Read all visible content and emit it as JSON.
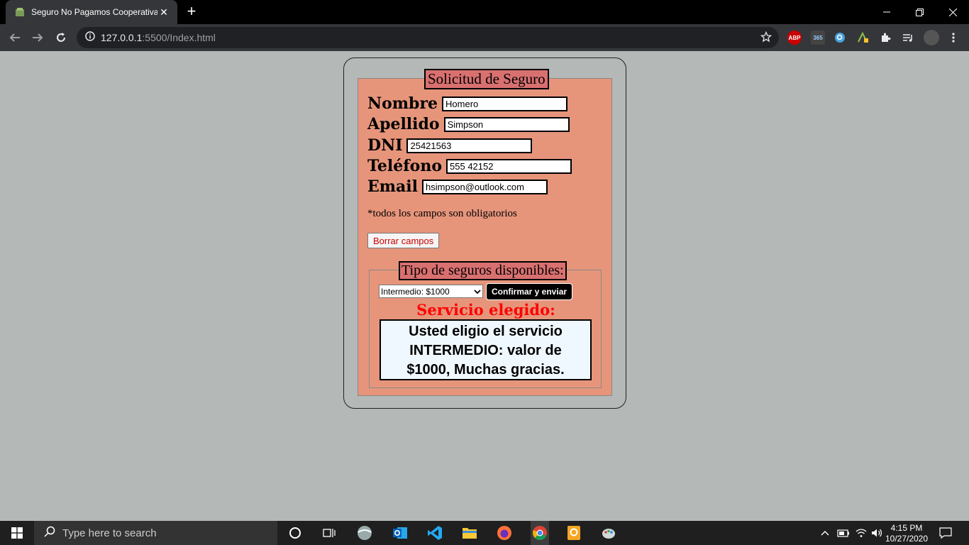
{
  "browser": {
    "tab_title": "Seguro No Pagamos Cooperativa",
    "url_host": "127.0.0.1",
    "url_rest": ":5500/Index.html",
    "extensions": [
      "ABP",
      "365"
    ]
  },
  "form": {
    "legend": "Solicitud de Seguro",
    "fields": [
      {
        "label": "Nombre",
        "value": "Homero"
      },
      {
        "label": "Apellido",
        "value": "Simpson"
      },
      {
        "label": "DNI",
        "value": "25421563"
      },
      {
        "label": "Teléfono",
        "value": "555 42152"
      },
      {
        "label": "Email",
        "value": "hsimpson@outlook.com"
      }
    ],
    "note": "*todos los campos son obligatorios",
    "clear_button": "Borrar campos"
  },
  "seguros": {
    "legend": "Tipo de seguros disponibles:",
    "selected_plan": "Intermedio: $1000",
    "confirm_button": "Confirmar y enviar",
    "result_title": "Servicio elegido:",
    "result_lines": [
      "Usted eligio el servicio",
      "INTERMEDIO: valor de",
      "$1000, Muchas gracias."
    ]
  },
  "taskbar": {
    "search_placeholder": "Type here to search",
    "time": "4:15 PM",
    "date": "10/27/2020"
  },
  "colors": {
    "page_bg": "#b4b8b6",
    "form_bg": "#e6957b",
    "legend_bg": "#d97070",
    "result_title": "#ff0000"
  }
}
